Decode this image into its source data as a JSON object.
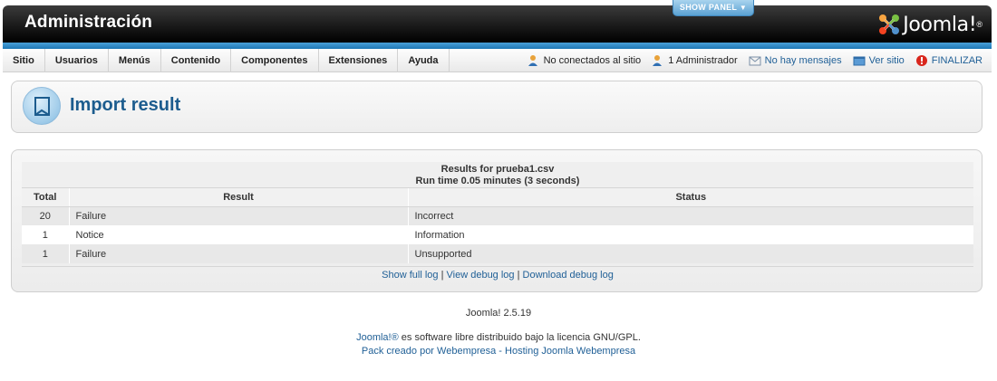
{
  "header": {
    "title": "Administración",
    "show_panel_label": "SHOW PANEL",
    "logo_text": "Joomla!",
    "logo_reg": "®"
  },
  "menu": {
    "items": [
      {
        "label": "Sitio"
      },
      {
        "label": "Usuarios"
      },
      {
        "label": "Menús"
      },
      {
        "label": "Contenido"
      },
      {
        "label": "Componentes"
      },
      {
        "label": "Extensiones"
      },
      {
        "label": "Ayuda"
      }
    ]
  },
  "status": {
    "visitors": "No conectados al sitio",
    "admins": "1 Administrador",
    "messages": "No hay mensajes",
    "view_site": "Ver sitio",
    "logout": "FINALIZAR"
  },
  "page": {
    "title": "Import result"
  },
  "results": {
    "file_line": "Results for prueba1.csv",
    "runtime_line": "Run time 0.05 minutes (3 seconds)",
    "columns": [
      "Total",
      "Result",
      "Status"
    ],
    "rows": [
      {
        "total": "20",
        "result": "Failure",
        "status": "Incorrect"
      },
      {
        "total": "1",
        "result": "Notice",
        "status": "Information"
      },
      {
        "total": "1",
        "result": "Failure",
        "status": "Unsupported"
      }
    ],
    "links": {
      "show_full_log": "Show full log",
      "view_debug_log": "View debug log",
      "download_debug_log": "Download debug log",
      "separator": " | "
    }
  },
  "footer": {
    "version": "Joomla! 2.5.19",
    "license_link": "Joomla!®",
    "license_text": " es software libre distribuido bajo la licencia GNU/GPL.",
    "pack_link": "Pack creado por Webempresa",
    "pack_sep": " - ",
    "hosting_link": "Hosting Joomla Webempresa"
  },
  "colors": {
    "accent_blue": "#1e78b6",
    "title_blue": "#1c5c8e",
    "link_blue": "#1f5f96",
    "logout_red": "#d9261c"
  }
}
